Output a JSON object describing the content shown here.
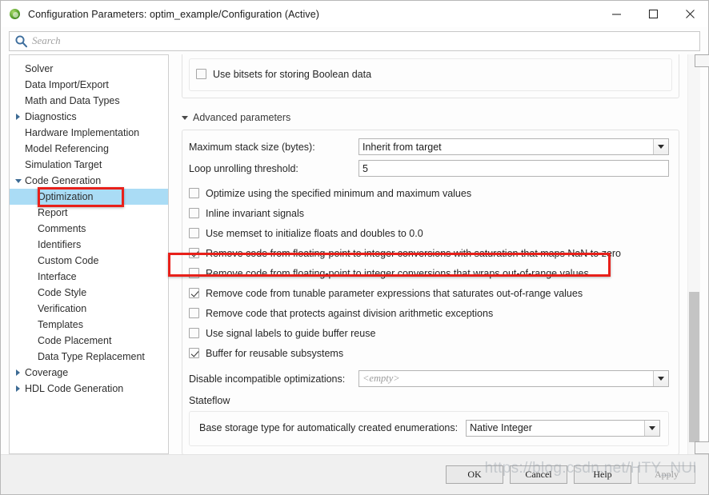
{
  "window": {
    "title": "Configuration Parameters: optim_example/Configuration (Active)",
    "app_icon": "simulink-icon",
    "minimize_label": "—",
    "maximize_label": "☐",
    "close_label": "✕"
  },
  "search": {
    "placeholder": "Search",
    "value": "",
    "icon": "search-icon"
  },
  "sidebar": {
    "items": [
      {
        "label": "Solver",
        "indent": 1,
        "arrow": "none",
        "selected": false
      },
      {
        "label": "Data Import/Export",
        "indent": 1,
        "arrow": "none",
        "selected": false
      },
      {
        "label": "Math and Data Types",
        "indent": 1,
        "arrow": "none",
        "selected": false
      },
      {
        "label": "Diagnostics",
        "indent": 0,
        "arrow": "collapsed",
        "selected": false
      },
      {
        "label": "Hardware Implementation",
        "indent": 1,
        "arrow": "none",
        "selected": false
      },
      {
        "label": "Model Referencing",
        "indent": 1,
        "arrow": "none",
        "selected": false
      },
      {
        "label": "Simulation Target",
        "indent": 1,
        "arrow": "none",
        "selected": false
      },
      {
        "label": "Code Generation",
        "indent": 0,
        "arrow": "expanded",
        "selected": false
      },
      {
        "label": "Optimization",
        "indent": 2,
        "arrow": "none",
        "selected": true
      },
      {
        "label": "Report",
        "indent": 2,
        "arrow": "none",
        "selected": false
      },
      {
        "label": "Comments",
        "indent": 2,
        "arrow": "none",
        "selected": false
      },
      {
        "label": "Identifiers",
        "indent": 2,
        "arrow": "none",
        "selected": false
      },
      {
        "label": "Custom Code",
        "indent": 2,
        "arrow": "none",
        "selected": false
      },
      {
        "label": "Interface",
        "indent": 2,
        "arrow": "none",
        "selected": false
      },
      {
        "label": "Code Style",
        "indent": 2,
        "arrow": "none",
        "selected": false
      },
      {
        "label": "Verification",
        "indent": 2,
        "arrow": "none",
        "selected": false
      },
      {
        "label": "Templates",
        "indent": 2,
        "arrow": "none",
        "selected": false
      },
      {
        "label": "Code Placement",
        "indent": 2,
        "arrow": "none",
        "selected": false
      },
      {
        "label": "Data Type Replacement",
        "indent": 2,
        "arrow": "none",
        "selected": false
      },
      {
        "label": "Coverage",
        "indent": 0,
        "arrow": "collapsed",
        "selected": false
      },
      {
        "label": "HDL Code Generation",
        "indent": 0,
        "arrow": "collapsed",
        "selected": false
      }
    ]
  },
  "main": {
    "partial_top_checkbox": {
      "label": "Use bitsets for storing Boolean data",
      "checked": false
    },
    "advanced_section": {
      "label": "Advanced parameters",
      "expanded": true
    },
    "fields": [
      {
        "label": "Maximum stack size (bytes):",
        "type": "combo",
        "value": "Inherit from target",
        "empty": false
      },
      {
        "label": "Loop unrolling threshold:",
        "type": "text",
        "value": "5",
        "empty": false
      }
    ],
    "checkboxes": [
      {
        "label": "Optimize using the specified minimum and maximum values",
        "checked": false,
        "highlighted": false
      },
      {
        "label": "Inline invariant signals",
        "checked": false,
        "highlighted": false
      },
      {
        "label": "Use memset to initialize floats and doubles to 0.0",
        "checked": false,
        "highlighted": false
      },
      {
        "label": "Remove code from floating-point to integer conversions with saturation that maps NaN to zero",
        "checked": true,
        "highlighted": false
      },
      {
        "label": "Remove code from floating-point to integer conversions that wraps out-of-range values",
        "checked": false,
        "highlighted": true
      },
      {
        "label": "Remove code from tunable parameter expressions that saturates out-of-range values",
        "checked": true,
        "highlighted": false
      },
      {
        "label": "Remove code that protects against division arithmetic exceptions",
        "checked": false,
        "highlighted": false
      },
      {
        "label": "Use signal labels to guide buffer reuse",
        "checked": false,
        "highlighted": false
      },
      {
        "label": "Buffer for reusable subsystems",
        "checked": true,
        "highlighted": false
      }
    ],
    "disable_incompatible": {
      "label": "Disable incompatible optimizations:",
      "value": "<empty>",
      "empty": true
    },
    "stateflow": {
      "group_label": "Stateflow",
      "base_storage": {
        "label": "Base storage type for automatically created enumerations:",
        "value": "Native Integer",
        "empty": false
      }
    }
  },
  "footer": {
    "buttons": [
      {
        "label": "OK",
        "disabled": false
      },
      {
        "label": "Cancel",
        "disabled": false
      },
      {
        "label": "Help",
        "disabled": false
      },
      {
        "label": "Apply",
        "disabled": true
      }
    ],
    "watermark": "https://blog.csdn.net/HTY_NUI"
  },
  "annotations": {
    "accent_color": "#e8201a",
    "selection_color": "#aadcf5"
  }
}
